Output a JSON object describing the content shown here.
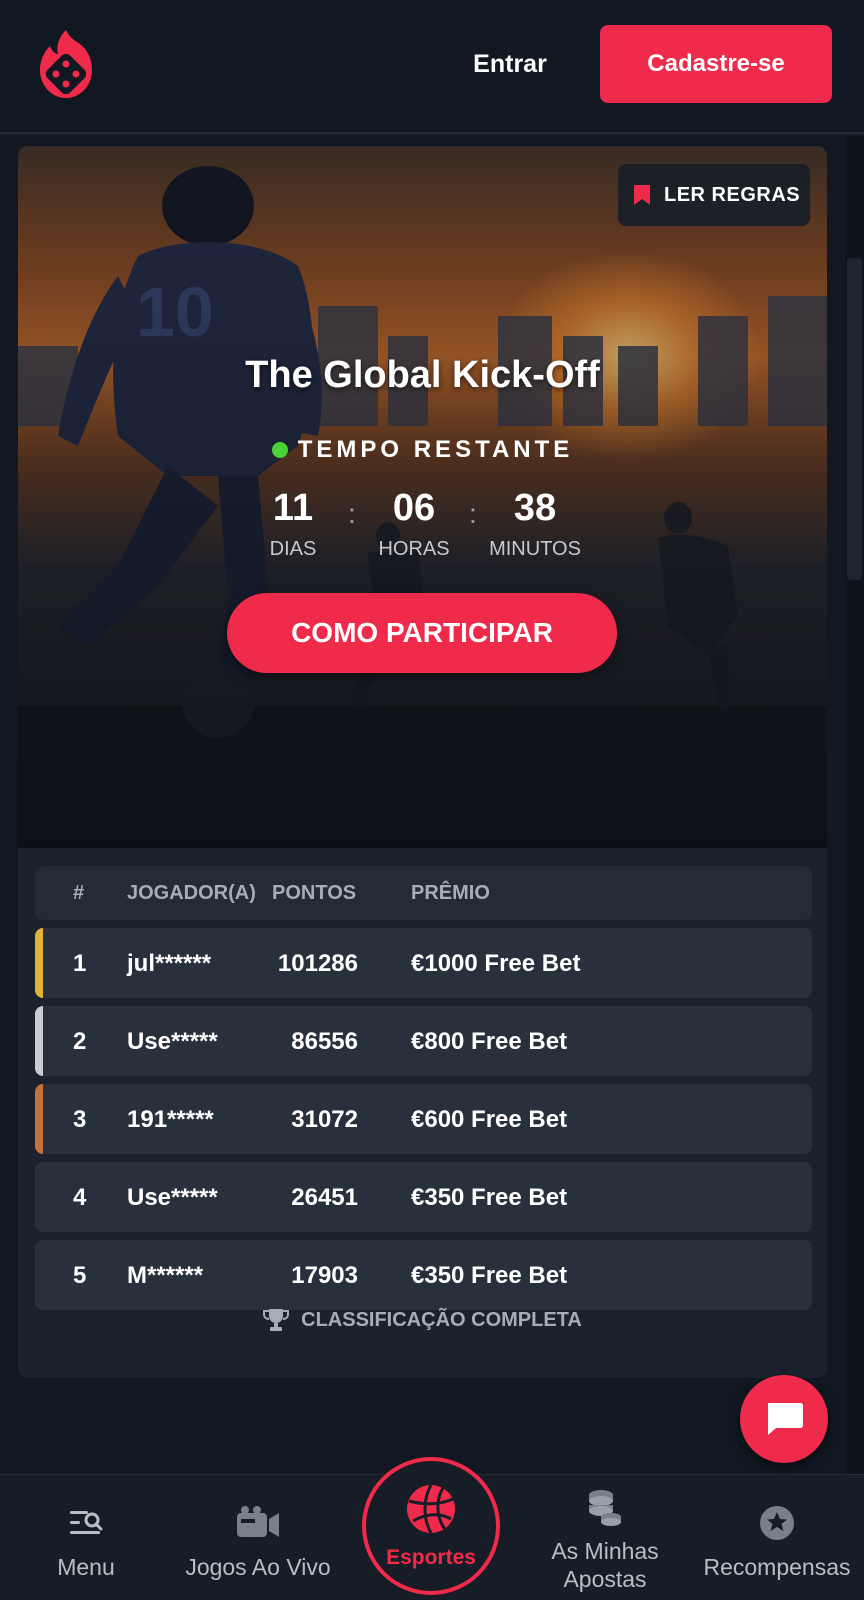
{
  "header": {
    "logo": "pokerdice-flame-logo",
    "login_label": "Entrar",
    "signup_label": "Cadastre-se"
  },
  "hero": {
    "rules_label": "LER REGRAS",
    "title": "The Global Kick-Off",
    "time_label": "TEMPO RESTANTE",
    "countdown": {
      "days": "11",
      "days_label": "DIAS",
      "hours": "06",
      "hours_label": "HORAS",
      "minutes": "38",
      "minutes_label": "MINUTOS",
      "separator": ":"
    },
    "cta_label": "COMO PARTICIPAR"
  },
  "leaderboard": {
    "headers": {
      "rank": "#",
      "player": "JOGADOR(A)",
      "points": "PONTOS",
      "prize": "PRÊMIO"
    },
    "rows": [
      {
        "rank": "1",
        "player": "jul******",
        "points": "101286",
        "prize": "€1000 Free Bet",
        "accent": "#e2b33a"
      },
      {
        "rank": "2",
        "player": "Use*****",
        "points": "86556",
        "prize": "€800 Free Bet",
        "accent": "#c8ccd2"
      },
      {
        "rank": "3",
        "player": "191*****",
        "points": "31072",
        "prize": "€600 Free Bet",
        "accent": "#c5713a"
      },
      {
        "rank": "4",
        "player": "Use*****",
        "points": "26451",
        "prize": "€350 Free Bet",
        "accent": ""
      },
      {
        "rank": "5",
        "player": "M******",
        "points": "17903",
        "prize": "€350 Free Bet",
        "accent": ""
      }
    ],
    "full_label": "CLASSIFICAÇÃO COMPLETA"
  },
  "nav": {
    "menu": "Menu",
    "live": "Jogos Ao Vivo",
    "sports": "Esportes",
    "bets_line1": "As Minhas",
    "bets_line2": "Apostas",
    "rewards": "Recompensas"
  },
  "colors": {
    "accent": "#f02a4a",
    "bg": "#111821",
    "live_dot": "#4cd137"
  }
}
